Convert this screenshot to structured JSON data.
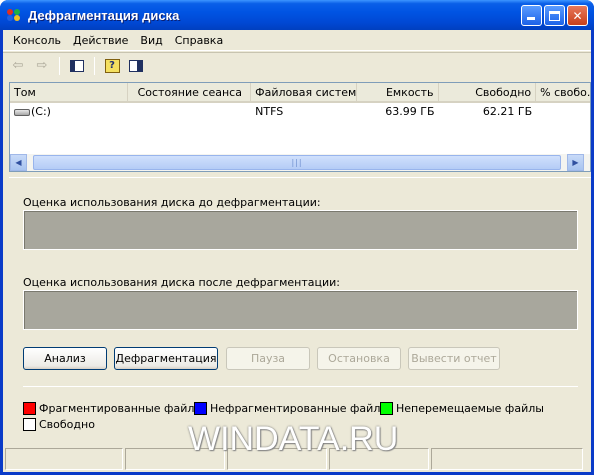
{
  "window": {
    "title": "Дефрагментация диска"
  },
  "menu": [
    "Консоль",
    "Действие",
    "Вид",
    "Справка"
  ],
  "listview": {
    "columns": [
      "Том",
      "Состояние сеанса",
      "Файловая система",
      "Емкость",
      "Свободно",
      "% свобо..."
    ],
    "rows": [
      {
        "volume": "(C:)",
        "session": "",
        "fs": "NTFS",
        "capacity": "63.99 ГБ",
        "free": "62.21 ГБ",
        "pct": ""
      }
    ]
  },
  "labels": {
    "before": "Оценка использования диска до дефрагментации:",
    "after": "Оценка использования диска после дефрагментации:"
  },
  "buttons": {
    "analyze": "Анализ",
    "defrag": "Дефрагментация",
    "pause": "Пауза",
    "stop": "Остановка",
    "report": "Вывести отчет"
  },
  "legend": [
    {
      "label": "Фрагментированные файлы",
      "color": "#ff0000"
    },
    {
      "label": "Нефрагментированные файлы",
      "color": "#0000ff"
    },
    {
      "label": "Неперемещаемые файлы",
      "color": "#00ff00"
    },
    {
      "label": "Свободно",
      "color": "#ffffff"
    }
  ],
  "watermark": "WINDATA.RU",
  "colors": {
    "title_bar": "#0054e3",
    "window_bg": "#ece9d8",
    "map_bg": "#a8a79d"
  }
}
